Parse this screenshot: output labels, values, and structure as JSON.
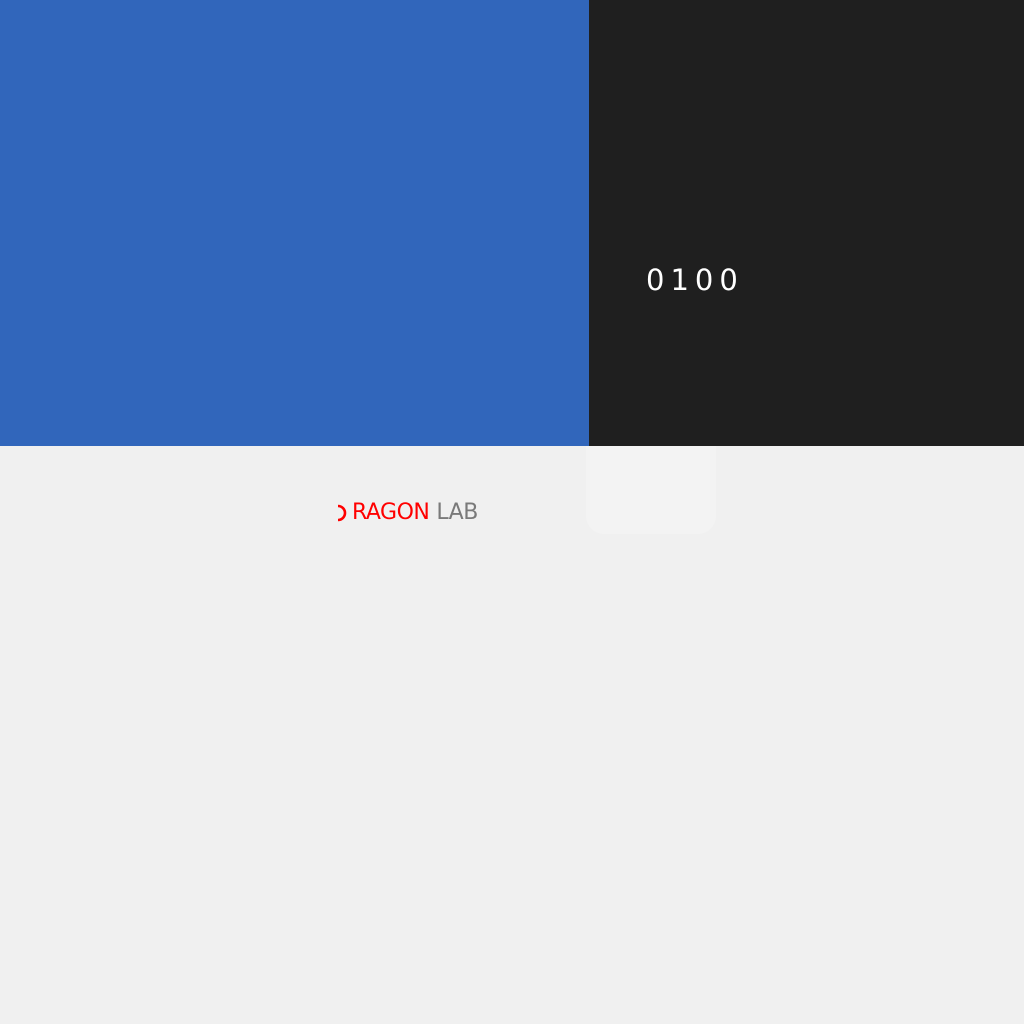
{
  "panels": {
    "code": "0100"
  },
  "logo": {
    "word_red": "RAGON",
    "word_gray": "LAB",
    "mark_icon": "reversed-c-icon"
  },
  "colors": {
    "blue_panel": "#3166bb",
    "dark_panel": "#1f1f1f",
    "background": "#f0f0f0",
    "logo_red": "#ff0000",
    "logo_gray": "#7a7a7a",
    "code_text": "#ffffff"
  }
}
